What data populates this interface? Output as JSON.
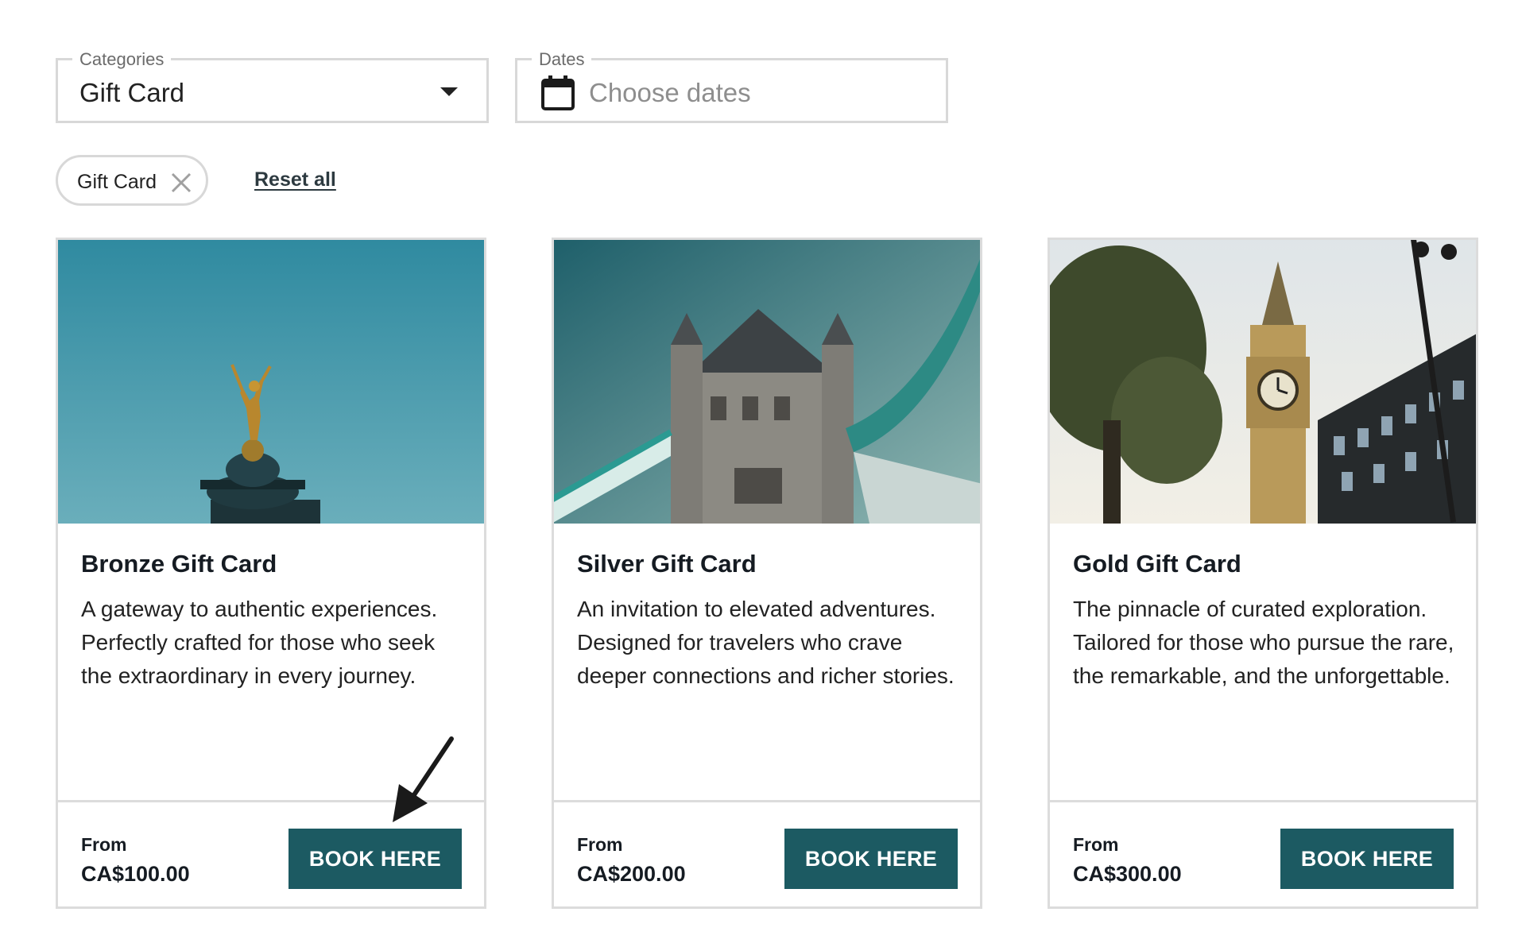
{
  "filters": {
    "categories": {
      "legend": "Categories",
      "value": "Gift Card"
    },
    "dates": {
      "legend": "Dates",
      "placeholder": "Choose dates"
    }
  },
  "active_filters": {
    "chip_label": "Gift Card",
    "reset_label": "Reset all"
  },
  "cards": [
    {
      "title": "Bronze Gift Card",
      "description": "A gateway to authentic experiences. Perfectly crafted for those who seek the extraordinary in every journey.",
      "from_label": "From",
      "price": "CA$100.00",
      "button_label": "BOOK HERE"
    },
    {
      "title": "Silver Gift Card",
      "description": "An invitation to elevated adventures. Designed for travelers who crave deeper connections and richer stories.",
      "from_label": "From",
      "price": "CA$200.00",
      "button_label": "BOOK HERE"
    },
    {
      "title": "Gold Gift Card",
      "description": "The pinnacle of curated exploration. Tailored for those who pursue the rare, the remarkable, and the unforgettable.",
      "from_label": "From",
      "price": "CA$300.00",
      "button_label": "BOOK HERE"
    }
  ],
  "colors": {
    "accent": "#1c5a62",
    "border": "#d8d8d8"
  },
  "icons": [
    "chevron-down-icon",
    "calendar-icon",
    "close-icon",
    "arrow-pointer-icon"
  ]
}
